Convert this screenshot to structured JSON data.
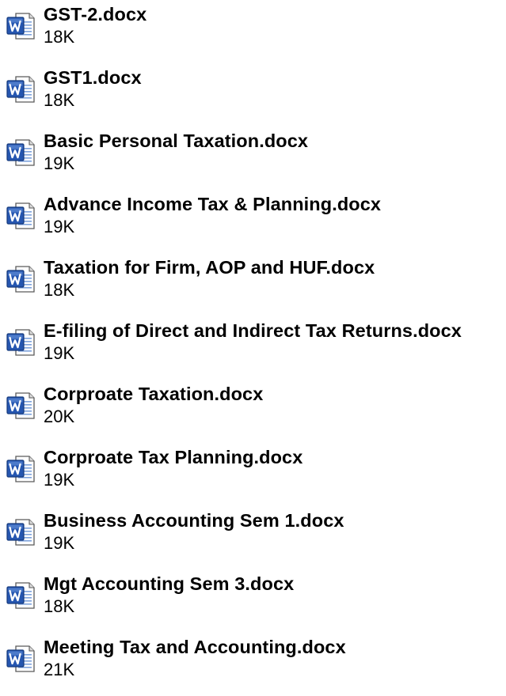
{
  "files": [
    {
      "name": "GST-2.docx",
      "size": "18K",
      "icon": "word-document-icon"
    },
    {
      "name": "GST1.docx",
      "size": "18K",
      "icon": "word-document-icon"
    },
    {
      "name": "Basic Personal Taxation.docx",
      "size": "19K",
      "icon": "word-document-icon"
    },
    {
      "name": "Advance Income Tax & Planning.docx",
      "size": "19K",
      "icon": "word-document-icon"
    },
    {
      "name": "Taxation for Firm, AOP and HUF.docx",
      "size": "18K",
      "icon": "word-document-icon"
    },
    {
      "name": "E-filing of Direct and Indirect Tax Returns.docx",
      "size": "19K",
      "icon": "word-document-icon"
    },
    {
      "name": "Corproate Taxation.docx",
      "size": "20K",
      "icon": "word-document-icon"
    },
    {
      "name": "Corproate Tax Planning.docx",
      "size": "19K",
      "icon": "word-document-icon"
    },
    {
      "name": "Business Accounting Sem 1.docx",
      "size": "19K",
      "icon": "word-document-icon"
    },
    {
      "name": "Mgt Accounting Sem 3.docx",
      "size": "18K",
      "icon": "word-document-icon"
    },
    {
      "name": "Meeting Tax and Accounting.docx",
      "size": "21K",
      "icon": "word-document-icon"
    }
  ],
  "colors": {
    "icon_blue": "#1f4fa3",
    "icon_blue_light": "#6f9be0",
    "page_background": "#ffffff",
    "text": "#000000"
  }
}
